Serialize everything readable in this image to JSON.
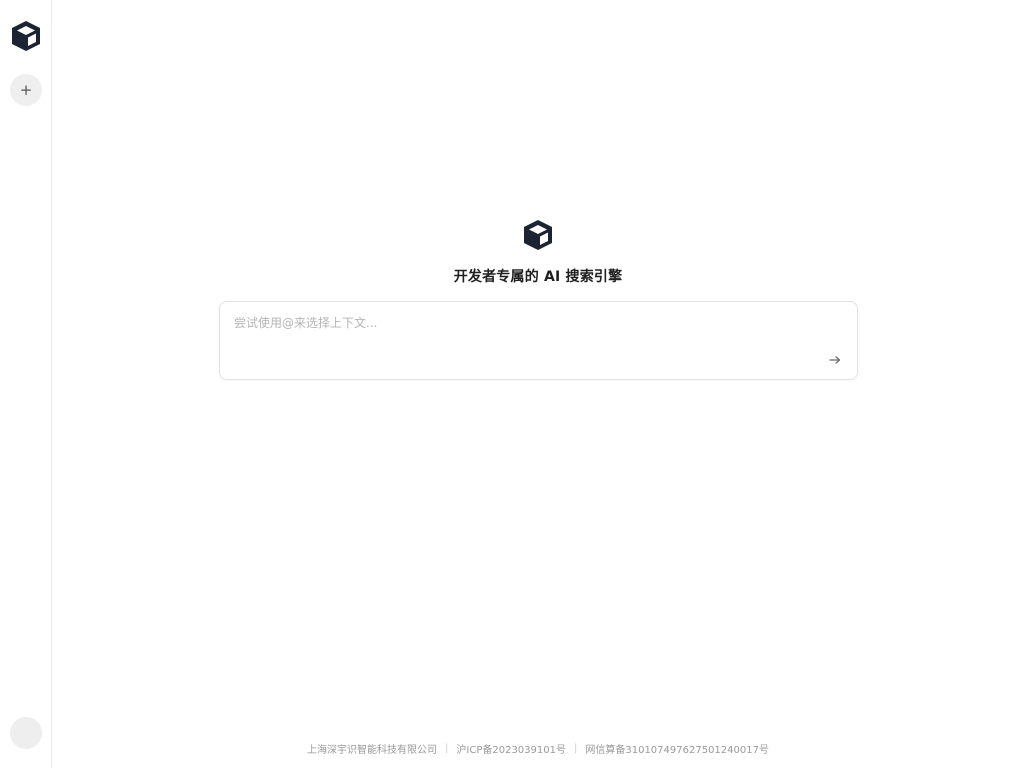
{
  "sidebar": {
    "logo_icon": "cube-logo-icon",
    "new_chat_icon": "plus-icon",
    "new_chat_symbol": "+",
    "avatar_icon": "user-avatar"
  },
  "main": {
    "hero_logo_icon": "cube-logo-icon",
    "title": "开发者专属的 AI 搜索引擎",
    "search": {
      "value": "",
      "placeholder": "尝试使用@来选择上下文...",
      "send_icon": "arrow-right-icon",
      "send_symbol": "→"
    }
  },
  "footer": {
    "company": "上海深宇识智能科技有限公司",
    "separator": "|",
    "icp": "沪ICP备2023039101号",
    "algorithm": "网信算备310107497627501240017号"
  },
  "colors": {
    "logo": "#1c2333",
    "sidebar_border": "#ececec",
    "button_bg": "#efefef",
    "footer_text": "#9a9a9a",
    "placeholder": "#b5b5b5"
  }
}
